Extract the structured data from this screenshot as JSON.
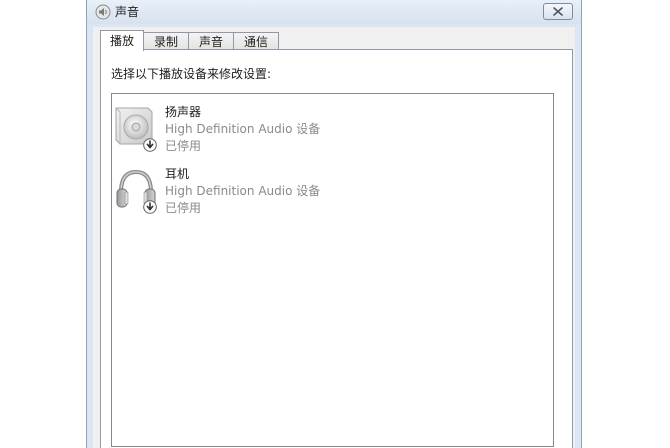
{
  "window": {
    "title": "声音",
    "title_icon": "speaker-icon",
    "close_icon": "close-icon"
  },
  "tabs": [
    {
      "label": "播放",
      "active": true
    },
    {
      "label": "录制",
      "active": false
    },
    {
      "label": "声音",
      "active": false
    },
    {
      "label": "通信",
      "active": false
    }
  ],
  "playback": {
    "instruction": "选择以下播放设备来修改设置:",
    "devices": [
      {
        "name": "扬声器",
        "description": "High Definition Audio 设备",
        "status": "已停用",
        "icon": "speaker-device-icon",
        "badge_icon": "disabled-arrow-icon"
      },
      {
        "name": "耳机",
        "description": "High Definition Audio 设备",
        "status": "已停用",
        "icon": "headphones-icon",
        "badge_icon": "disabled-arrow-icon"
      }
    ]
  },
  "colors": {
    "window_frame": "#dbe6f2",
    "client_bg": "#f0f0f0",
    "disabled_text": "#8a8a8a"
  }
}
